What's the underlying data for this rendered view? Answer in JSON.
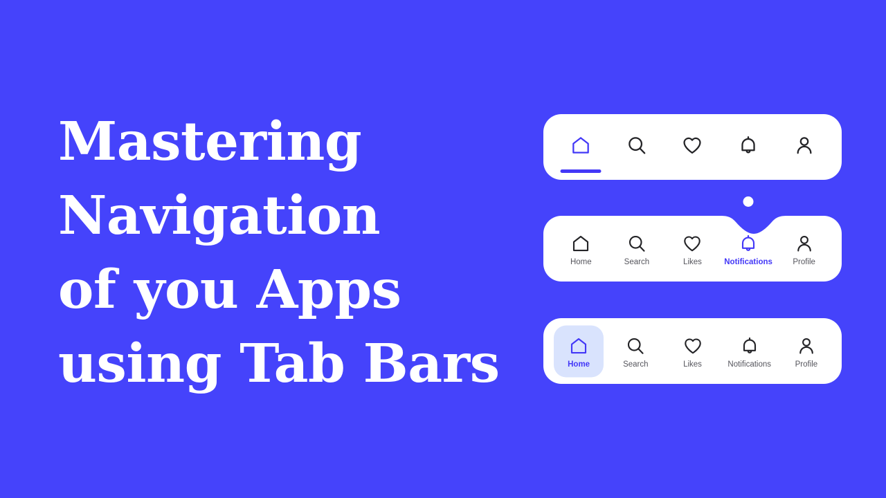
{
  "theme": {
    "background": "#4543fb",
    "card_background": "#ffffff",
    "accent": "#4338f7",
    "active_pill_background": "#d9e3fd",
    "inactive_label": "#55555c",
    "icon_stroke": "#232326",
    "headline_color": "#ffffff"
  },
  "headline": {
    "text": "Mastering\nNavigation\nof you Apps\nusing Tab Bars",
    "lines": [
      "Mastering",
      "Navigation",
      "of you Apps",
      "using Tab Bars"
    ]
  },
  "tab_bars": [
    {
      "id": "tabbar-icons-only",
      "style": "icons-only-with-underline",
      "active_index": 0,
      "indicator": "underline",
      "tabs": [
        {
          "label": "Home",
          "icon": "home-icon",
          "show_label": false,
          "active": true
        },
        {
          "label": "Search",
          "icon": "search-icon",
          "show_label": false,
          "active": false
        },
        {
          "label": "Likes",
          "icon": "heart-icon",
          "show_label": false,
          "active": false
        },
        {
          "label": "Notifications",
          "icon": "bell-icon",
          "show_label": false,
          "active": false
        },
        {
          "label": "Profile",
          "icon": "person-icon",
          "show_label": false,
          "active": false
        }
      ]
    },
    {
      "id": "tabbar-notched",
      "style": "icons-with-labels-notched",
      "active_index": 3,
      "indicator": "notch-dot",
      "tabs": [
        {
          "label": "Home",
          "icon": "home-icon",
          "show_label": true,
          "active": false
        },
        {
          "label": "Search",
          "icon": "search-icon",
          "show_label": true,
          "active": false
        },
        {
          "label": "Likes",
          "icon": "heart-icon",
          "show_label": true,
          "active": false
        },
        {
          "label": "Notifications",
          "icon": "bell-icon",
          "show_label": true,
          "active": true
        },
        {
          "label": "Profile",
          "icon": "person-icon",
          "show_label": true,
          "active": false
        }
      ]
    },
    {
      "id": "tabbar-pill",
      "style": "icons-with-labels-pill",
      "active_index": 0,
      "indicator": "pill",
      "tabs": [
        {
          "label": "Home",
          "icon": "home-icon",
          "show_label": true,
          "active": true
        },
        {
          "label": "Search",
          "icon": "search-icon",
          "show_label": true,
          "active": false
        },
        {
          "label": "Likes",
          "icon": "heart-icon",
          "show_label": true,
          "active": false
        },
        {
          "label": "Notifications",
          "icon": "bell-icon",
          "show_label": true,
          "active": false
        },
        {
          "label": "Profile",
          "icon": "person-icon",
          "show_label": true,
          "active": false
        }
      ]
    }
  ]
}
